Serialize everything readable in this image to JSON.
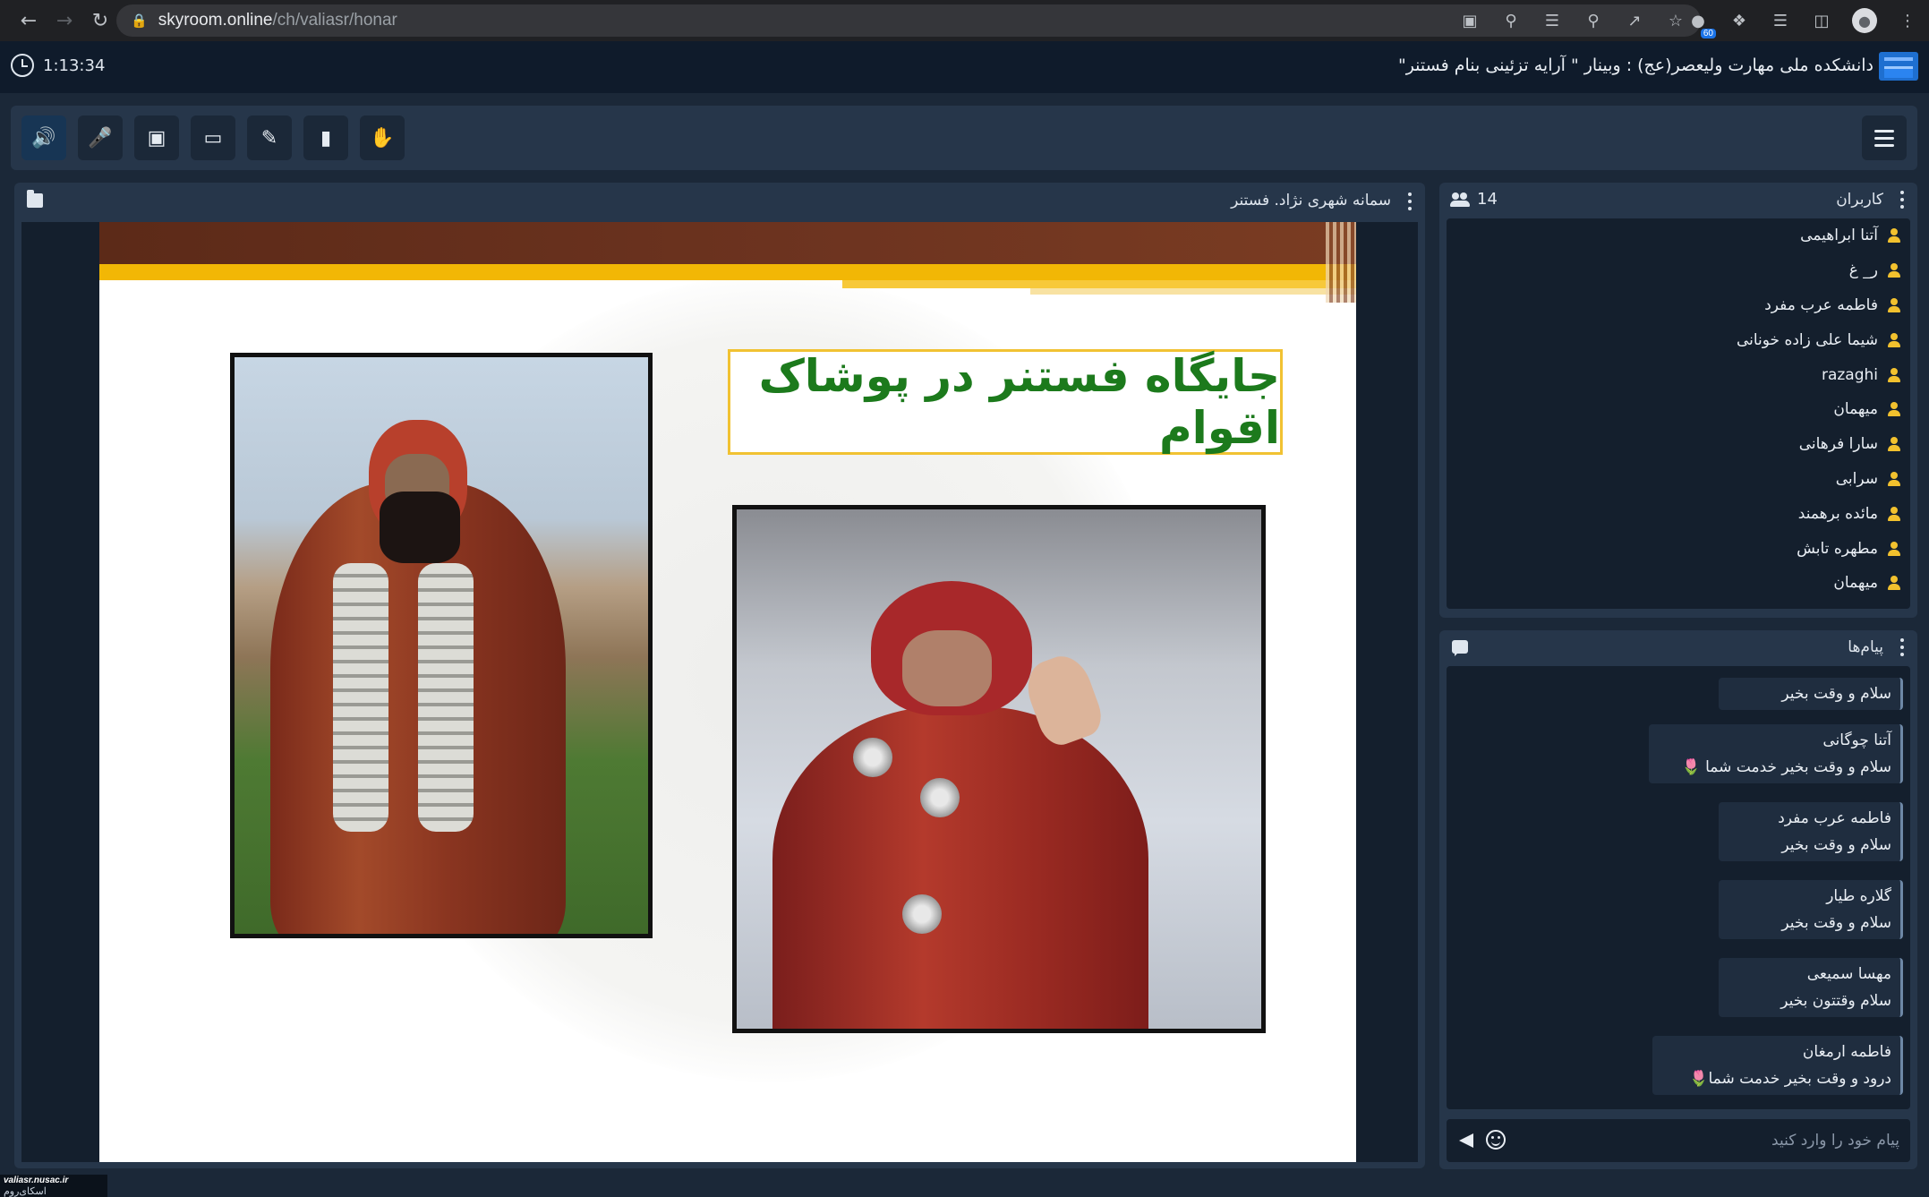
{
  "browser": {
    "url_host": "skyroom.online",
    "url_path": "/ch/valiasr/honar",
    "extension_badge": "60"
  },
  "header": {
    "timer": "1:13:34",
    "room_title": "دانشکده ملی مهارت ولیعصر(عج) : وبینار \" آرایه تزئینی بنام فستنر\""
  },
  "presentation": {
    "title": "سمانه شهری نژاد. فستنر",
    "slide_heading": "جایگاه فستنر در پوشاک اقوام"
  },
  "users": {
    "title": "کاربران",
    "count": "14",
    "items": [
      "آتنا ابراهیمی",
      "ر_ غ",
      "فاطمه عرب مفرد",
      "شیما علی زاده خونانی",
      "razaghi",
      "میهمان",
      "سارا فرهانی",
      "سرابی",
      "مائده برهمند",
      "مطهره تابش",
      "میهمان"
    ]
  },
  "messages": {
    "title": "پیام‌ها",
    "items": [
      {
        "sender": "",
        "text": "سلام و وقت بخیر"
      },
      {
        "sender": "آتنا چوگانی",
        "text": "سلام و وقت بخیر خدمت شما 🌷"
      },
      {
        "sender": "فاطمه عرب مفرد",
        "text": "سلام و وقت بخیر"
      },
      {
        "sender": "گلاره طیار",
        "text": "سلام و وقت بخیر"
      },
      {
        "sender": "مهسا سمیعی",
        "text": "سلام وقتتون بخیر"
      },
      {
        "sender": "فاطمه ارمغان",
        "text": "درود و وقت بخیر خدمت شما🌷"
      }
    ],
    "input_placeholder": "پیام خود را وارد کنید"
  },
  "watermark": {
    "site": "valiasr.nusac.ir",
    "brand": "اسکای‌روم"
  },
  "colors": {
    "app_bg": "#1b2838",
    "panel_bg": "#26364a",
    "active_tool": "#4ea8ff",
    "user_icon": "#f2c12e",
    "slide_heading": "#1c7a1c"
  }
}
